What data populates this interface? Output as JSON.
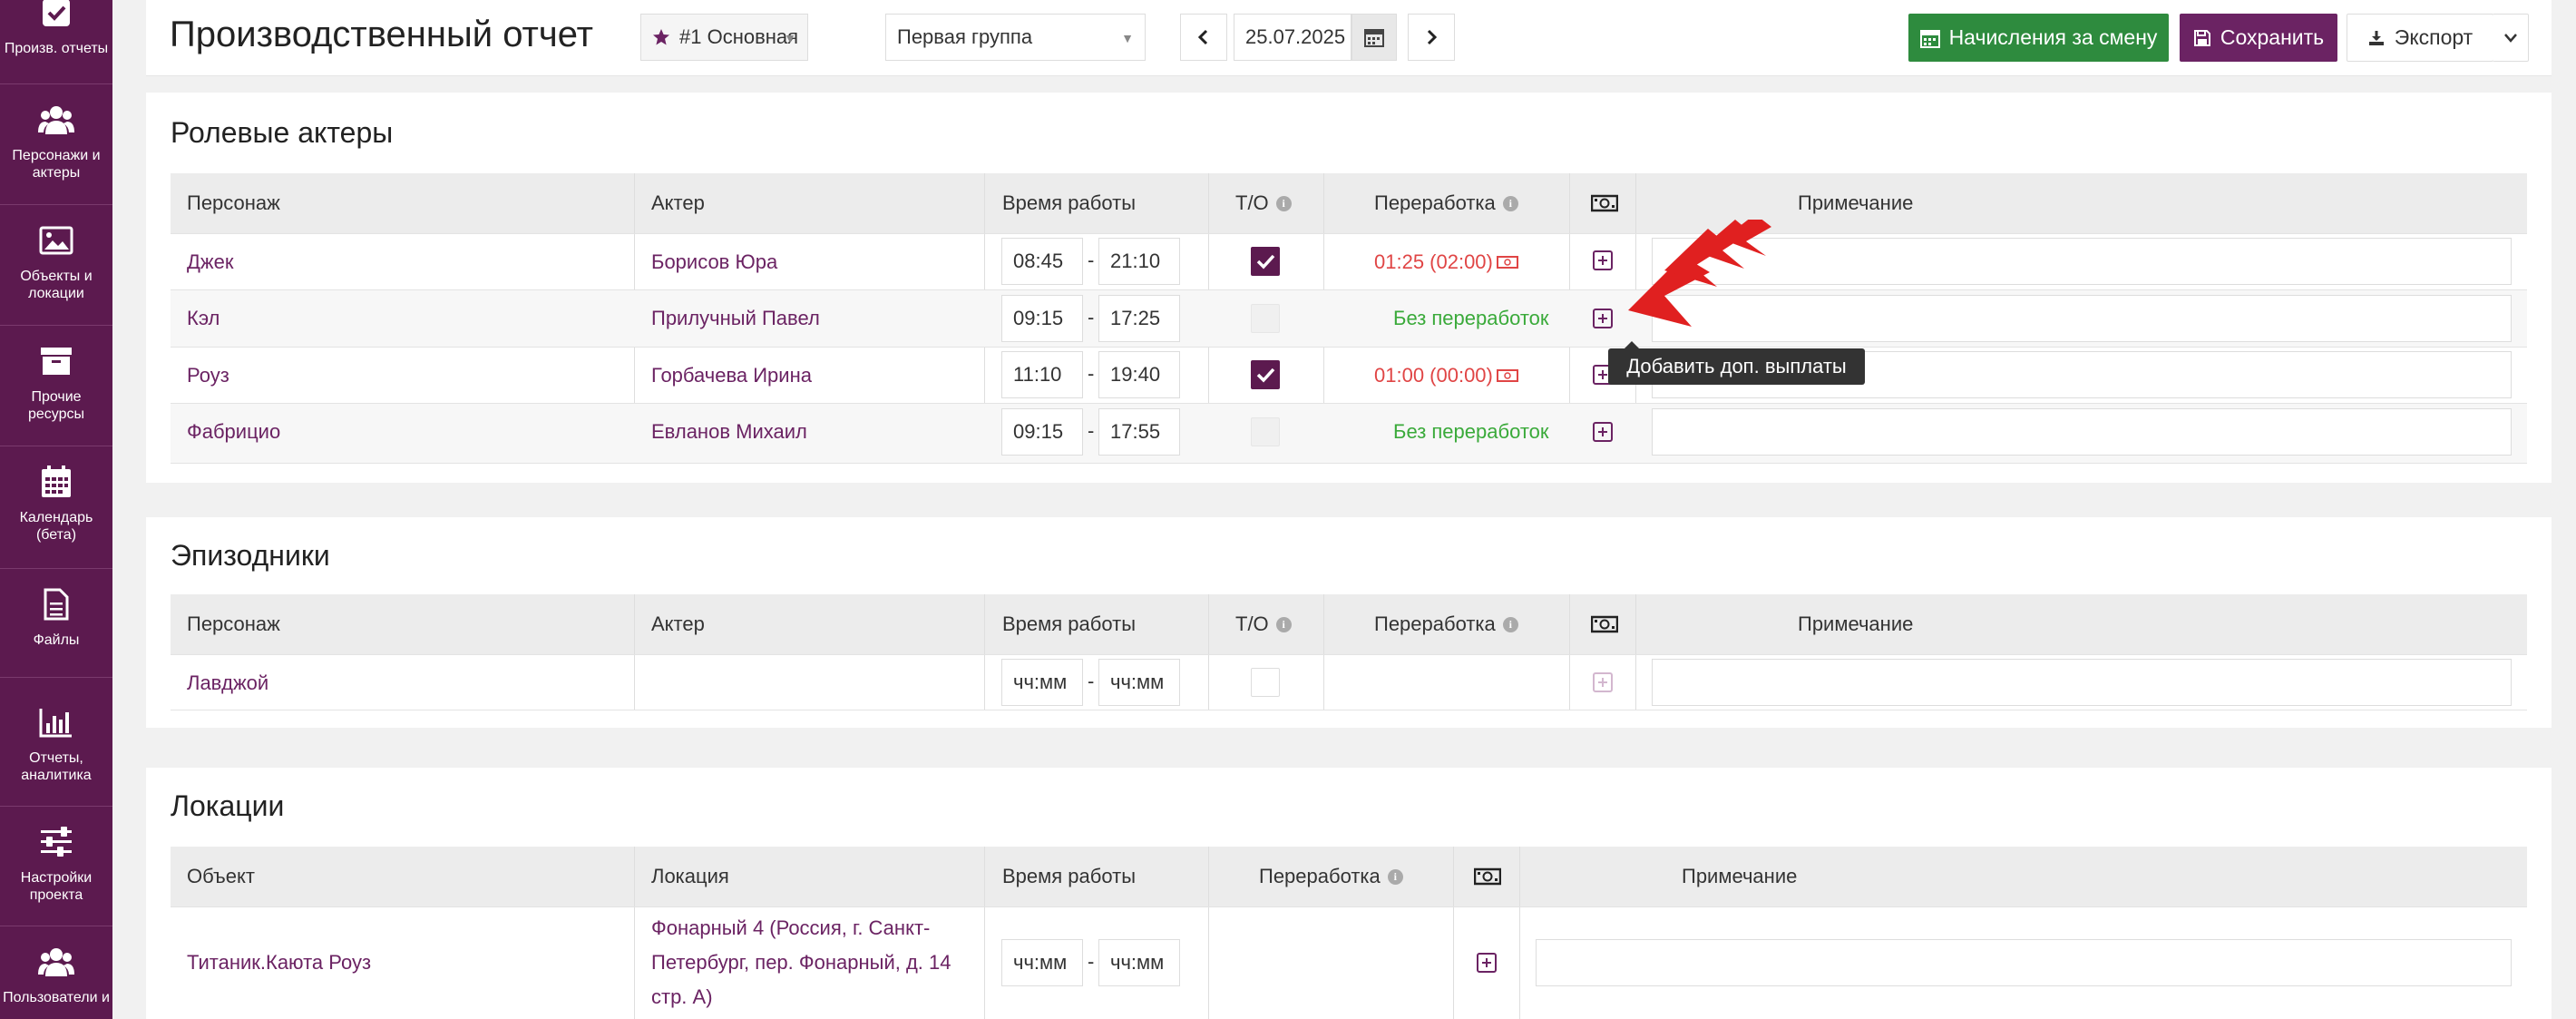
{
  "sidebar": {
    "items": [
      {
        "label": "Произв. отчеты",
        "icon": "check-icon"
      },
      {
        "label": "Персонажи и актеры",
        "icon": "users-icon"
      },
      {
        "label": "Объекты и локации",
        "icon": "image-icon"
      },
      {
        "label": "Прочие ресурсы",
        "icon": "archive-icon"
      },
      {
        "label": "Календарь (бета)",
        "icon": "calendar-icon"
      },
      {
        "label": "Файлы",
        "icon": "file-icon"
      },
      {
        "label": "Отчеты, аналитика",
        "icon": "bar-chart-icon"
      },
      {
        "label": "Настройки проекта",
        "icon": "sliders-icon"
      },
      {
        "label": "Пользователи и",
        "icon": "users-icon"
      }
    ]
  },
  "header": {
    "title": "Производственный отчет",
    "unit_select": "#1 Основная",
    "group_select": "Первая группа",
    "date": "25.07.2025",
    "accruals_button": "Начисления за смену",
    "save_button": "Сохранить",
    "export_button": "Экспорт"
  },
  "colors": {
    "brand": "#5c1a4f",
    "accent": "#6b2363",
    "green": "#2e8b3e",
    "overtime_red": "#e04545",
    "overtime_none": "#3aaa3a"
  },
  "role_actors": {
    "title": "Ролевые актеры",
    "columns": {
      "character": "Персонаж",
      "actor": "Актер",
      "work_time": "Время работы",
      "to": "Т/О",
      "overtime": "Переработка",
      "note": "Примечание"
    },
    "rows": [
      {
        "character": "Джек",
        "actor": "Борисов Юра",
        "start": "08:45",
        "end": "21:10",
        "to_checked": true,
        "overtime": "01:25 (02:00)",
        "overtime_kind": "red"
      },
      {
        "character": "Кэл",
        "actor": "Прилучный Павел",
        "start": "09:15",
        "end": "17:25",
        "to_checked": false,
        "overtime": "Без переработок",
        "overtime_kind": "green"
      },
      {
        "character": "Роуз",
        "actor": "Горбачева Ирина",
        "start": "11:10",
        "end": "19:40",
        "to_checked": true,
        "overtime": "01:00 (00:00)",
        "overtime_kind": "red"
      },
      {
        "character": "Фабрицио",
        "actor": "Евланов Михаил",
        "start": "09:15",
        "end": "17:55",
        "to_checked": false,
        "overtime": "Без переработок",
        "overtime_kind": "green"
      }
    ]
  },
  "episodic": {
    "title": "Эпизодники",
    "columns": {
      "character": "Персонаж",
      "actor": "Актер",
      "work_time": "Время работы",
      "to": "Т/О",
      "overtime": "Переработка",
      "note": "Примечание"
    },
    "rows": [
      {
        "character": "Лавджой",
        "actor": "",
        "start": "чч:мм",
        "end": "чч:мм"
      }
    ]
  },
  "locations": {
    "title": "Локации",
    "columns": {
      "object": "Объект",
      "location": "Локация",
      "work_time": "Время работы",
      "overtime": "Переработка",
      "note": "Примечание"
    },
    "rows": [
      {
        "object": "Титаник.Каюта Роуз",
        "location_line1": "Фонарный 4 (Россия, г. Санкт-",
        "location_line2": "Петербург, пер. Фонарный, д. 14",
        "location_line3": "стр. А)",
        "start": "чч:мм",
        "end": "чч:мм"
      }
    ]
  },
  "tooltip": "Добавить доп. выплаты",
  "time_separator": "-"
}
